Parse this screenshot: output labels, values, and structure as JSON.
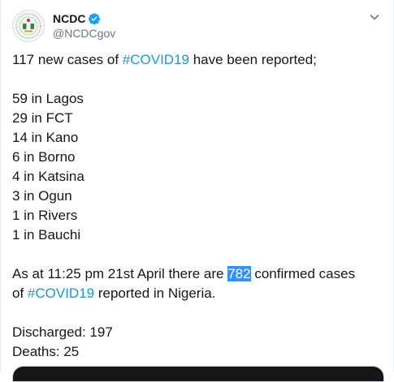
{
  "author": {
    "display_name": "NCDC",
    "handle": "@NCDCgov",
    "verified": true,
    "avatar_icon": "ncdc-logo-icon"
  },
  "menu": {
    "caret_icon": "chevron-down-icon"
  },
  "tweet": {
    "intro_before": "117 new cases of ",
    "intro_hashtag": "#COVID19",
    "intro_after": " have been reported;",
    "states": [
      "59 in Lagos",
      "29 in FCT",
      "14 in Kano",
      "6 in Borno",
      "4 in Katsina",
      "3 in Ogun",
      "1 in Rivers",
      "1 in Bauchi"
    ],
    "summary_before": "As at 11:25 pm 21st April there are ",
    "summary_total": "782",
    "summary_after": " confirmed cases",
    "summary2_before": "of ",
    "summary2_hashtag": "#COVID19",
    "summary2_after": " reported in Nigeria.",
    "discharged": "Discharged: 197",
    "deaths": "Deaths: 25"
  },
  "colors": {
    "link": "#1b95e0",
    "verified_badge": "#1da1f2",
    "selection": "#3390ff"
  }
}
